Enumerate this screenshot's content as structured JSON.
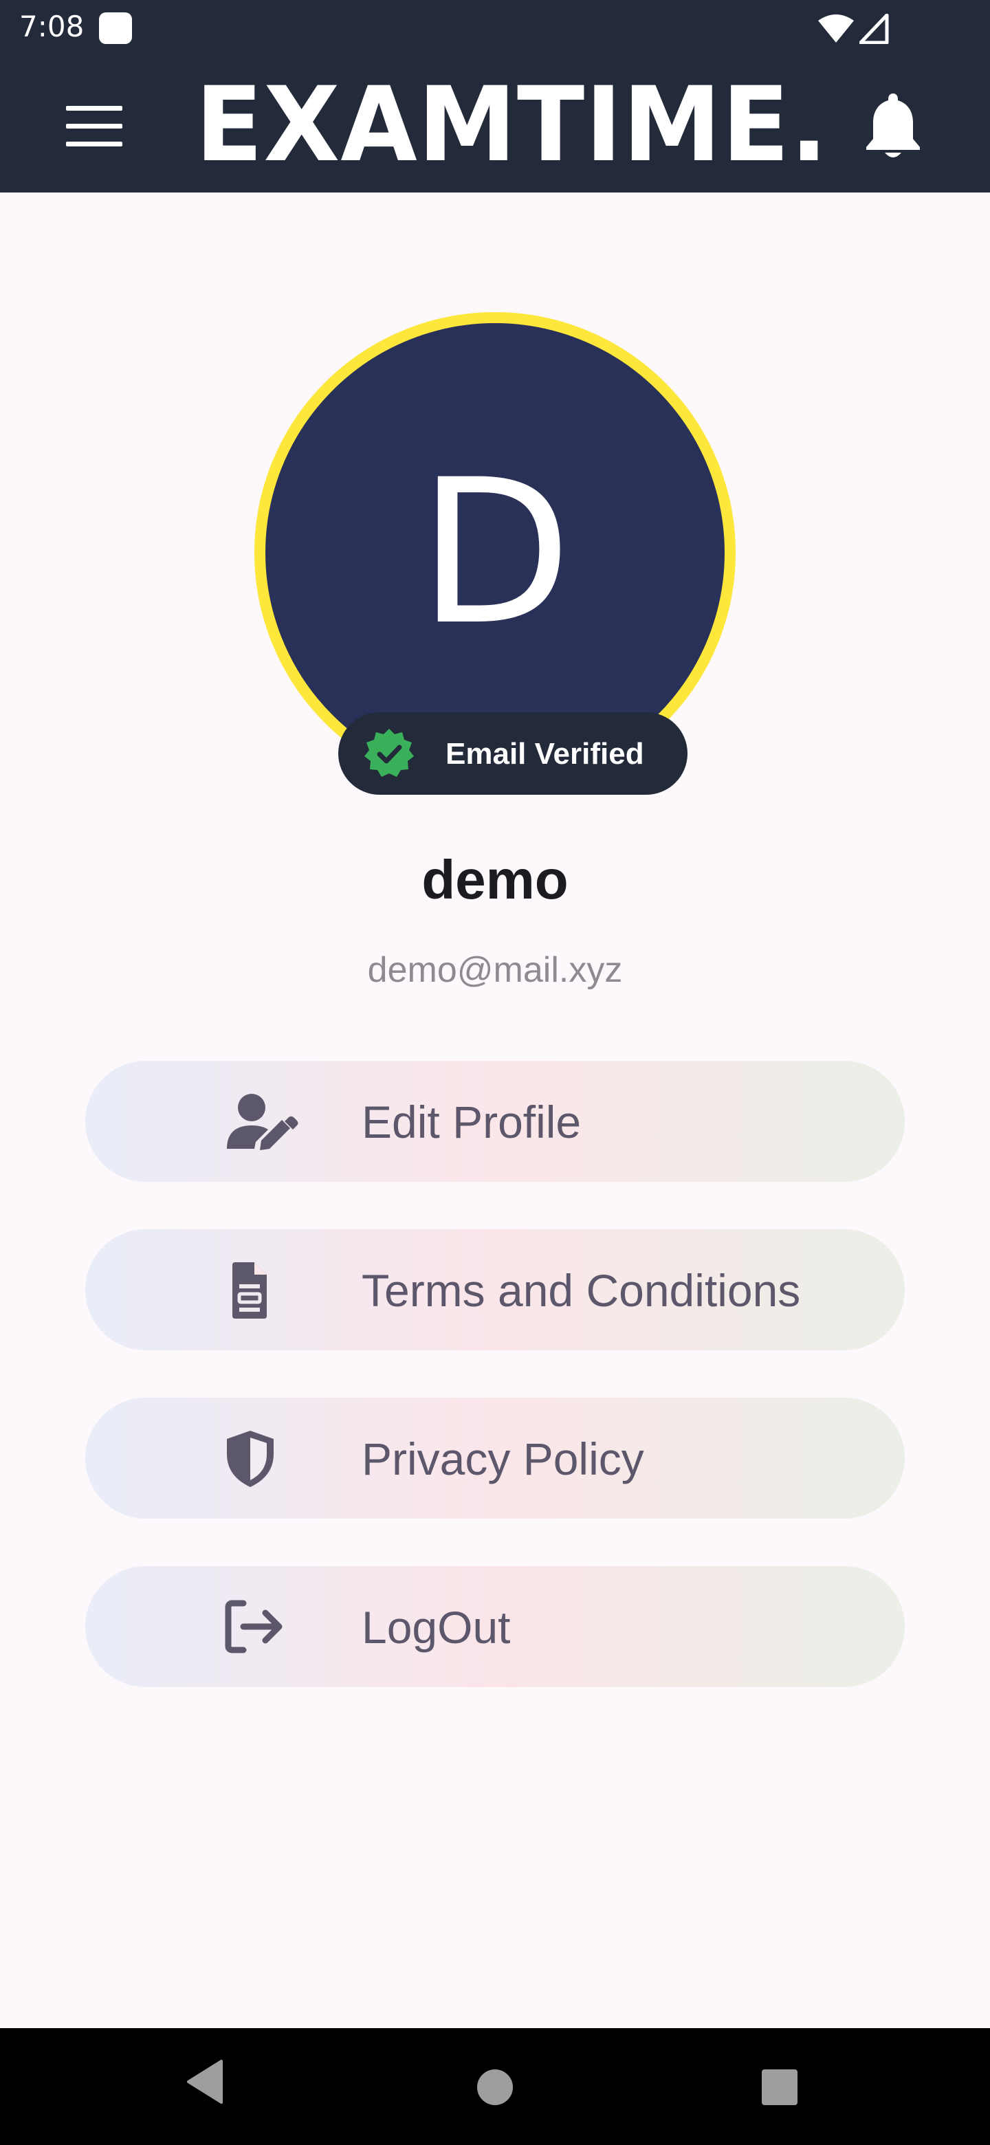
{
  "status_bar": {
    "time": "7:08"
  },
  "app_bar": {
    "title": "EXAMTIME."
  },
  "profile": {
    "avatar_letter": "D",
    "verified_label": "Email Verified",
    "name": "demo",
    "email": "demo@mail.xyz"
  },
  "actions": [
    {
      "label": "Edit Profile",
      "icon": "user-edit-icon"
    },
    {
      "label": "Terms and Conditions",
      "icon": "document-icon"
    },
    {
      "label": "Privacy Policy",
      "icon": "shield-icon"
    },
    {
      "label": "LogOut",
      "icon": "logout-icon"
    }
  ],
  "colors": {
    "app_bar": "#232a3a",
    "avatar_fill": "#2a3159",
    "avatar_ring": "#fce73a",
    "verified_badge": "#3bb05a",
    "action_text": "#5d576b",
    "background": "#fdf8fb"
  }
}
